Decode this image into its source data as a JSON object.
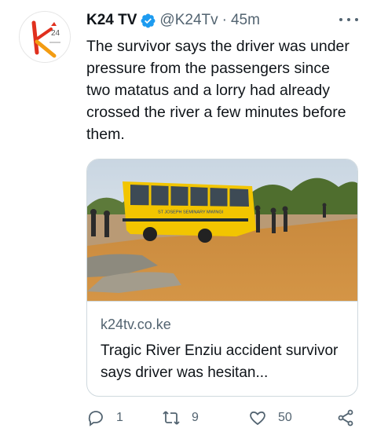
{
  "tweet": {
    "author_name": "K24 TV",
    "handle": "@K24Tv",
    "separator": "·",
    "time": "45m",
    "text": "The survivor says the driver was under pressure from the passengers since two matatus and a lorry had already crossed the river a few minutes before them.",
    "avatar_icon": "k24-logo-icon",
    "verified_icon": "verified-badge-icon"
  },
  "card": {
    "image_icon": "bus-in-river-photo",
    "bus_sign": "ST JOSEPH SEMINARY MWINGI",
    "domain": "k24tv.co.ke",
    "title": "Tragic River Enziu accident survivor says driver was hesitan..."
  },
  "actions": {
    "reply_count": "1",
    "retweet_count": "9",
    "like_count": "50"
  },
  "colors": {
    "verified": "#1d9bf0",
    "text_secondary": "#536471",
    "border": "#cfd9de",
    "logo_red": "#e0301e",
    "logo_orange": "#f39c12"
  }
}
